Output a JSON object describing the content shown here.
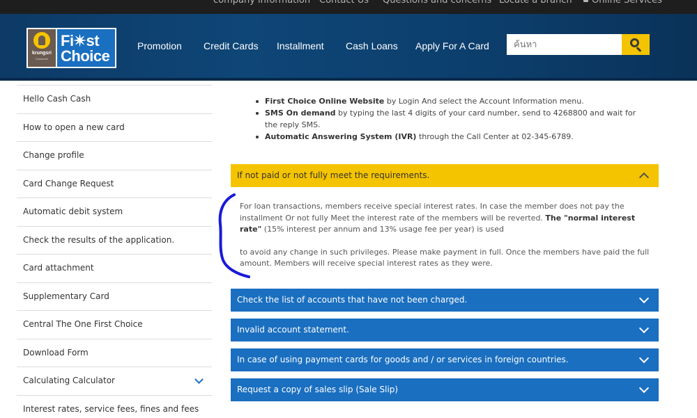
{
  "topbar": {
    "links": [
      "company information",
      "Contact Us",
      "Questions and concerns",
      "Locate a branch"
    ],
    "online_services": "Online Services"
  },
  "logo": {
    "brand_name": "First Choice",
    "line1": "Fi✴st",
    "line2": "Choice",
    "bank": "krungsri",
    "bank_sub": "Consumer"
  },
  "nav": [
    "Promotion",
    "Credit Cards",
    "Installment",
    "Cash Loans",
    "Apply For A Card"
  ],
  "search": {
    "placeholder": "ค้นหา",
    "icon": "search-icon"
  },
  "sidebar": {
    "items": [
      "Hello Cash Cash",
      "How to open a new card",
      "Change profile",
      "Card Change Request",
      "Automatic debit system",
      "Check the results of the application.",
      "Card attachment",
      "Supplementary Card",
      "Central The One First Choice",
      "Download Form",
      "Calculating Calculator",
      "Interest rates, service fees, fines and fees"
    ]
  },
  "bullets": [
    {
      "bold": "First Choice Online Website",
      "text": " by Login And select the Account Information menu."
    },
    {
      "bold": "SMS On demand",
      "text": " by typing the last 4 digits of your card number, send to 4268800 and wait for the reply SMS."
    },
    {
      "bold": "Automatic Answering System (IVR)",
      "text": " through the Call Center at 02-345-6789."
    }
  ],
  "accordion": [
    {
      "title": "If not paid or not fully meet the requirements.",
      "expanded": true,
      "body": {
        "p1_start": "For loan transactions, members receive special interest rates. In case the member does not pay the installment Or not fully Meet the interest rate of the members will be reverted. ",
        "p1_bold": "The \"normal interest rate\"",
        "p1_end": " (15% interest per annum and 13% usage fee per year) is used",
        "p2": "to avoid any change in such privileges. Please make payment in full. Once the members have paid the full amount. Members will receive special interest rates as they were."
      }
    },
    {
      "title": "Check the list of accounts that have not been charged.",
      "expanded": false
    },
    {
      "title": "Invalid account statement.",
      "expanded": false
    },
    {
      "title": "In case of using payment cards for goods and / or services in foreign countries.",
      "expanded": false
    },
    {
      "title": "Request a copy of sales slip (Sale Slip)",
      "expanded": false
    }
  ],
  "colors": {
    "header_blue": "#0e4677",
    "brand_blue": "#1a6fc0",
    "brand_yellow": "#f5c400",
    "annotation": "#1a1ad6"
  }
}
